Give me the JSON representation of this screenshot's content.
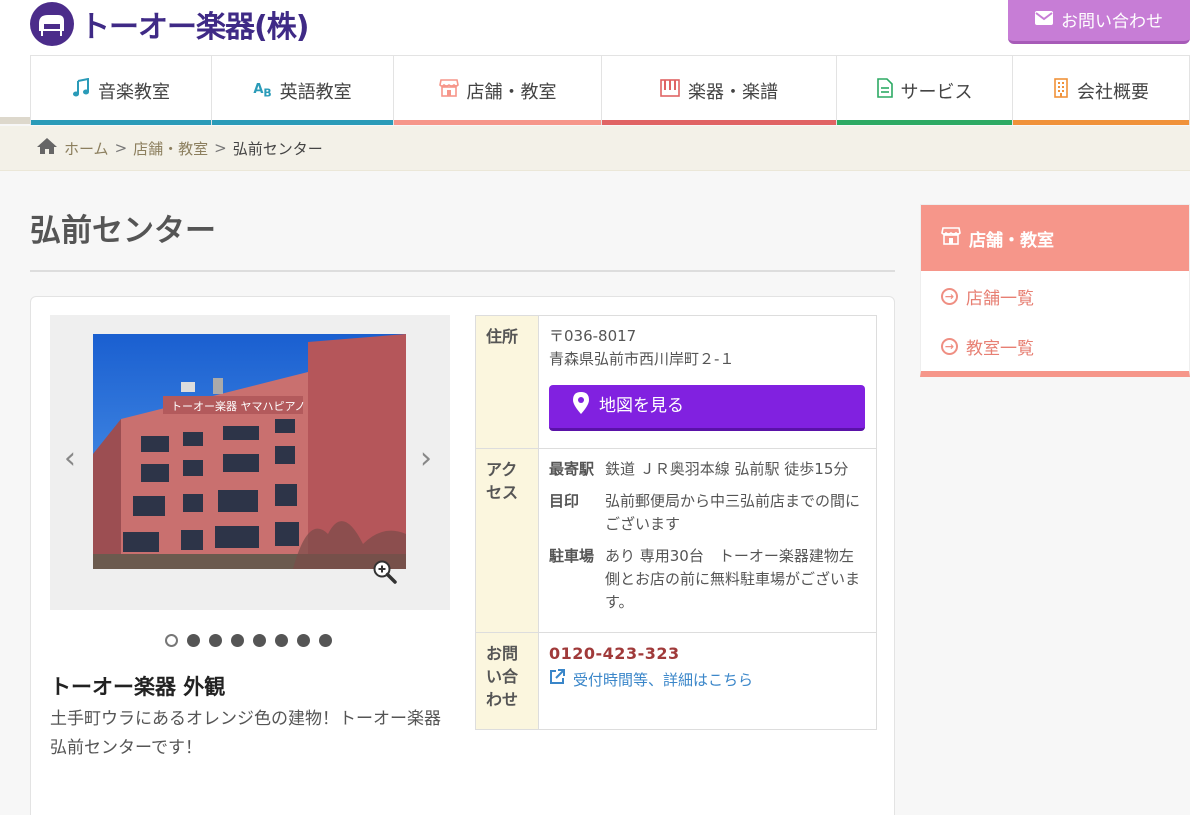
{
  "brand": {
    "name": "トーオー楽器(株)"
  },
  "header": {
    "contact_label": "お問い合わせ"
  },
  "nav": [
    {
      "label": "音楽教室",
      "color": "#2a9bb8",
      "icon": "music-note-icon"
    },
    {
      "label": "英語教室",
      "color": "#2a9bb8",
      "icon": "abc-icon"
    },
    {
      "label": "店舗・教室",
      "color": "#f6968a",
      "icon": "store-icon"
    },
    {
      "label": "楽器・楽譜",
      "color": "#e06464",
      "icon": "piano-keys-icon"
    },
    {
      "label": "サービス",
      "color": "#2daa64",
      "icon": "document-icon"
    },
    {
      "label": "会社概要",
      "color": "#f0923a",
      "icon": "building-icon"
    }
  ],
  "breadcrumb": {
    "home": "ホーム",
    "sep1": ">",
    "section": "店舗・教室",
    "sep2": ">",
    "current": "弘前センター"
  },
  "page": {
    "title": "弘前センター"
  },
  "gallery": {
    "caption_title": "トーオー楽器 外観",
    "caption_text": "土手町ウラにあるオレンジ色の建物！トーオー楽器 弘前センターです！",
    "signage": "トーオー楽器 ヤマハピアノ",
    "slide_count": 8,
    "active_index": 0
  },
  "info": {
    "address": {
      "label": "住所",
      "postal": "〒036-8017",
      "line": "青森県弘前市西川岸町２-１",
      "map_button": "地図を見る"
    },
    "access": {
      "label": "アクセス",
      "items": [
        {
          "k": "最寄駅",
          "v": "鉄道 ＪＲ奥羽本線 弘前駅 徒歩15分"
        },
        {
          "k": "目印",
          "v": "弘前郵便局から中三弘前店までの間にございます"
        },
        {
          "k": "駐車場",
          "v": "あり 専用30台　トーオー楽器建物左側とお店の前に無料駐車場がございます。"
        }
      ]
    },
    "contact": {
      "label": "お問い合わせ",
      "tel": "0120-423-323",
      "link": "受付時間等、詳細はこちら"
    }
  },
  "sidebar": {
    "title": "店舗・教室",
    "items": [
      {
        "label": "店舗一覧"
      },
      {
        "label": "教室一覧"
      }
    ]
  }
}
